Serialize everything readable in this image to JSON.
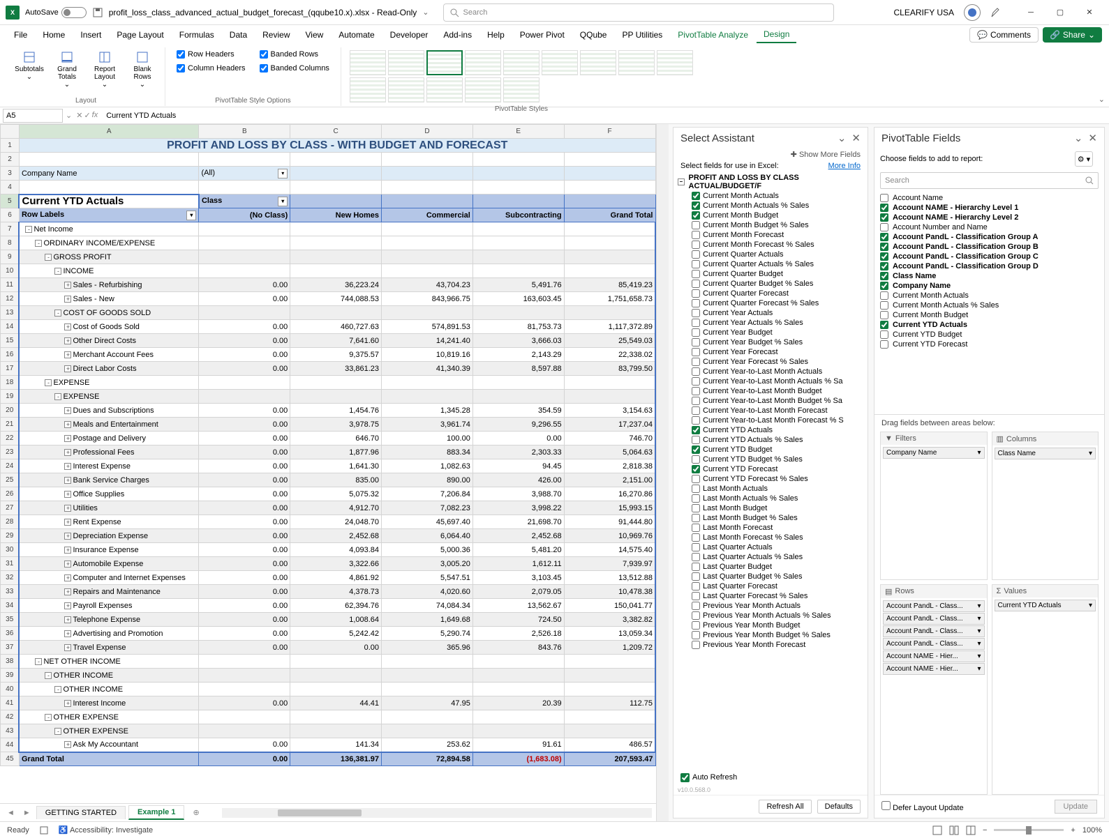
{
  "titlebar": {
    "autosave": "AutoSave",
    "autosave_state": "Off",
    "filename": "profit_loss_class_advanced_actual_budget_forecast_(qqube10.x).xlsx - Read-Only",
    "search_placeholder": "Search",
    "user": "CLEARIFY USA"
  },
  "menu": [
    "File",
    "Home",
    "Insert",
    "Page Layout",
    "Formulas",
    "Data",
    "Review",
    "View",
    "Automate",
    "Developer",
    "Add-ins",
    "Help",
    "Power Pivot",
    "QQube",
    "PP Utilities",
    "PivotTable Analyze",
    "Design"
  ],
  "menu_right": {
    "comments": "Comments",
    "share": "Share"
  },
  "ribbon": {
    "layout": {
      "label": "Layout",
      "subtotals": "Subtotals",
      "grand": "Grand\nTotals",
      "report": "Report\nLayout",
      "blank": "Blank\nRows"
    },
    "style_opts": {
      "label": "PivotTable Style Options",
      "row_headers": "Row Headers",
      "banded_rows": "Banded Rows",
      "col_headers": "Column Headers",
      "banded_cols": "Banded Columns"
    },
    "styles": {
      "label": "PivotTable Styles"
    }
  },
  "fxbar": {
    "cell": "A5",
    "formula": "Current YTD Actuals"
  },
  "sheet": {
    "title": "PROFIT AND LOSS BY CLASS - WITH BUDGET AND FORECAST",
    "company_label": "Company Name",
    "company_val": "(All)",
    "actuals": "Current YTD Actuals",
    "class": "Class",
    "row_labels": "Row Labels",
    "cols": [
      "(No Class)",
      "New Homes",
      "Commercial",
      "Subcontracting",
      "Grand Total"
    ],
    "rows": [
      {
        "n": 7,
        "l": "Net Income",
        "i": 1,
        "e": "-"
      },
      {
        "n": 8,
        "l": "ORDINARY INCOME/EXPENSE",
        "i": 2,
        "e": "-"
      },
      {
        "n": 9,
        "l": "GROSS PROFIT",
        "i": 3,
        "e": "-",
        "b": 1
      },
      {
        "n": 10,
        "l": "INCOME",
        "i": 4,
        "e": "-"
      },
      {
        "n": 11,
        "l": "Sales - Refurbishing",
        "i": 5,
        "e": "+",
        "b": 1,
        "v": [
          "0.00",
          "36,223.24",
          "43,704.23",
          "5,491.76",
          "85,419.23"
        ]
      },
      {
        "n": 12,
        "l": "Sales - New",
        "i": 5,
        "e": "+",
        "v": [
          "0.00",
          "744,088.53",
          "843,966.75",
          "163,603.45",
          "1,751,658.73"
        ]
      },
      {
        "n": 13,
        "l": "COST OF GOODS SOLD",
        "i": 4,
        "e": "-",
        "b": 1
      },
      {
        "n": 14,
        "l": "Cost of Goods Sold",
        "i": 5,
        "e": "+",
        "v": [
          "0.00",
          "460,727.63",
          "574,891.53",
          "81,753.73",
          "1,117,372.89"
        ]
      },
      {
        "n": 15,
        "l": "Other Direct Costs",
        "i": 5,
        "e": "+",
        "b": 1,
        "v": [
          "0.00",
          "7,641.60",
          "14,241.40",
          "3,666.03",
          "25,549.03"
        ]
      },
      {
        "n": 16,
        "l": "Merchant Account Fees",
        "i": 5,
        "e": "+",
        "v": [
          "0.00",
          "9,375.57",
          "10,819.16",
          "2,143.29",
          "22,338.02"
        ]
      },
      {
        "n": 17,
        "l": "Direct Labor Costs",
        "i": 5,
        "e": "+",
        "b": 1,
        "v": [
          "0.00",
          "33,861.23",
          "41,340.39",
          "8,597.88",
          "83,799.50"
        ]
      },
      {
        "n": 18,
        "l": "EXPENSE",
        "i": 3,
        "e": "-"
      },
      {
        "n": 19,
        "l": "EXPENSE",
        "i": 4,
        "e": "-",
        "b": 1
      },
      {
        "n": 20,
        "l": "Dues and Subscriptions",
        "i": 5,
        "e": "+",
        "v": [
          "0.00",
          "1,454.76",
          "1,345.28",
          "354.59",
          "3,154.63"
        ]
      },
      {
        "n": 21,
        "l": "Meals and Entertainment",
        "i": 5,
        "e": "+",
        "b": 1,
        "v": [
          "0.00",
          "3,978.75",
          "3,961.74",
          "9,296.55",
          "17,237.04"
        ]
      },
      {
        "n": 22,
        "l": "Postage and Delivery",
        "i": 5,
        "e": "+",
        "v": [
          "0.00",
          "646.70",
          "100.00",
          "0.00",
          "746.70"
        ]
      },
      {
        "n": 23,
        "l": "Professional Fees",
        "i": 5,
        "e": "+",
        "b": 1,
        "v": [
          "0.00",
          "1,877.96",
          "883.34",
          "2,303.33",
          "5,064.63"
        ]
      },
      {
        "n": 24,
        "l": "Interest Expense",
        "i": 5,
        "e": "+",
        "v": [
          "0.00",
          "1,641.30",
          "1,082.63",
          "94.45",
          "2,818.38"
        ]
      },
      {
        "n": 25,
        "l": "Bank Service Charges",
        "i": 5,
        "e": "+",
        "b": 1,
        "v": [
          "0.00",
          "835.00",
          "890.00",
          "426.00",
          "2,151.00"
        ]
      },
      {
        "n": 26,
        "l": "Office Supplies",
        "i": 5,
        "e": "+",
        "v": [
          "0.00",
          "5,075.32",
          "7,206.84",
          "3,988.70",
          "16,270.86"
        ]
      },
      {
        "n": 27,
        "l": "Utilities",
        "i": 5,
        "e": "+",
        "b": 1,
        "v": [
          "0.00",
          "4,912.70",
          "7,082.23",
          "3,998.22",
          "15,993.15"
        ]
      },
      {
        "n": 28,
        "l": "Rent Expense",
        "i": 5,
        "e": "+",
        "v": [
          "0.00",
          "24,048.70",
          "45,697.40",
          "21,698.70",
          "91,444.80"
        ]
      },
      {
        "n": 29,
        "l": "Depreciation Expense",
        "i": 5,
        "e": "+",
        "b": 1,
        "v": [
          "0.00",
          "2,452.68",
          "6,064.40",
          "2,452.68",
          "10,969.76"
        ]
      },
      {
        "n": 30,
        "l": "Insurance Expense",
        "i": 5,
        "e": "+",
        "v": [
          "0.00",
          "4,093.84",
          "5,000.36",
          "5,481.20",
          "14,575.40"
        ]
      },
      {
        "n": 31,
        "l": "Automobile Expense",
        "i": 5,
        "e": "+",
        "b": 1,
        "v": [
          "0.00",
          "3,322.66",
          "3,005.20",
          "1,612.11",
          "7,939.97"
        ]
      },
      {
        "n": 32,
        "l": "Computer and Internet Expenses",
        "i": 5,
        "e": "+",
        "v": [
          "0.00",
          "4,861.92",
          "5,547.51",
          "3,103.45",
          "13,512.88"
        ]
      },
      {
        "n": 33,
        "l": "Repairs and Maintenance",
        "i": 5,
        "e": "+",
        "b": 1,
        "v": [
          "0.00",
          "4,378.73",
          "4,020.60",
          "2,079.05",
          "10,478.38"
        ]
      },
      {
        "n": 34,
        "l": "Payroll Expenses",
        "i": 5,
        "e": "+",
        "v": [
          "0.00",
          "62,394.76",
          "74,084.34",
          "13,562.67",
          "150,041.77"
        ]
      },
      {
        "n": 35,
        "l": "Telephone Expense",
        "i": 5,
        "e": "+",
        "b": 1,
        "v": [
          "0.00",
          "1,008.64",
          "1,649.68",
          "724.50",
          "3,382.82"
        ]
      },
      {
        "n": 36,
        "l": "Advertising and Promotion",
        "i": 5,
        "e": "+",
        "v": [
          "0.00",
          "5,242.42",
          "5,290.74",
          "2,526.18",
          "13,059.34"
        ]
      },
      {
        "n": 37,
        "l": "Travel Expense",
        "i": 5,
        "e": "+",
        "b": 1,
        "v": [
          "0.00",
          "0.00",
          "365.96",
          "843.76",
          "1,209.72"
        ]
      },
      {
        "n": 38,
        "l": "NET OTHER INCOME",
        "i": 2,
        "e": "-"
      },
      {
        "n": 39,
        "l": "OTHER INCOME",
        "i": 3,
        "e": "-",
        "b": 1
      },
      {
        "n": 40,
        "l": "OTHER INCOME",
        "i": 4,
        "e": "-"
      },
      {
        "n": 41,
        "l": "Interest Income",
        "i": 5,
        "e": "+",
        "b": 1,
        "v": [
          "0.00",
          "44.41",
          "47.95",
          "20.39",
          "112.75"
        ]
      },
      {
        "n": 42,
        "l": "OTHER EXPENSE",
        "i": 3,
        "e": "-"
      },
      {
        "n": 43,
        "l": "OTHER EXPENSE",
        "i": 4,
        "e": "-",
        "b": 1
      },
      {
        "n": 44,
        "l": "Ask My Accountant",
        "i": 5,
        "e": "+",
        "v": [
          "0.00",
          "141.34",
          "253.62",
          "91.61",
          "486.57"
        ]
      }
    ],
    "grand_total": {
      "label": "Grand Total",
      "v": [
        "0.00",
        "136,381.97",
        "72,894.58",
        "(1,683.08)",
        "207,593.47"
      ]
    }
  },
  "panel1": {
    "title": "Select Assistant",
    "show_more": "Show More Fields",
    "instr": "Select fields for use in Excel:",
    "more": "More Info",
    "root": "PROFIT AND LOSS BY CLASS ACTUAL/BUDGET/F",
    "items": [
      {
        "l": "Current Month Actuals",
        "c": 1
      },
      {
        "l": "Current Month Actuals % Sales",
        "c": 1
      },
      {
        "l": "Current Month Budget",
        "c": 1
      },
      {
        "l": "Current Month Budget % Sales"
      },
      {
        "l": "Current Month Forecast"
      },
      {
        "l": "Current Month Forecast % Sales"
      },
      {
        "l": "Current Quarter Actuals"
      },
      {
        "l": "Current Quarter Actuals % Sales"
      },
      {
        "l": "Current Quarter Budget"
      },
      {
        "l": "Current Quarter Budget % Sales"
      },
      {
        "l": "Current Quarter Forecast"
      },
      {
        "l": "Current Quarter Forecast % Sales"
      },
      {
        "l": "Current Year Actuals"
      },
      {
        "l": "Current Year Actuals % Sales"
      },
      {
        "l": "Current Year Budget"
      },
      {
        "l": "Current Year Budget % Sales"
      },
      {
        "l": "Current Year Forecast"
      },
      {
        "l": "Current Year Forecast % Sales"
      },
      {
        "l": "Current Year-to-Last Month Actuals"
      },
      {
        "l": "Current Year-to-Last Month Actuals % Sa"
      },
      {
        "l": "Current Year-to-Last Month Budget"
      },
      {
        "l": "Current Year-to-Last Month Budget % Sa"
      },
      {
        "l": "Current Year-to-Last Month Forecast"
      },
      {
        "l": "Current Year-to-Last Month Forecast % S"
      },
      {
        "l": "Current YTD Actuals",
        "c": 1
      },
      {
        "l": "Current YTD Actuals % Sales"
      },
      {
        "l": "Current YTD Budget",
        "c": 1
      },
      {
        "l": "Current YTD Budget % Sales"
      },
      {
        "l": "Current YTD Forecast",
        "c": 1
      },
      {
        "l": "Current YTD Forecast % Sales"
      },
      {
        "l": "Last Month Actuals"
      },
      {
        "l": "Last Month Actuals % Sales"
      },
      {
        "l": "Last Month Budget"
      },
      {
        "l": "Last Month Budget % Sales"
      },
      {
        "l": "Last Month Forecast"
      },
      {
        "l": "Last Month Forecast % Sales"
      },
      {
        "l": "Last Quarter Actuals"
      },
      {
        "l": "Last Quarter Actuals % Sales"
      },
      {
        "l": "Last Quarter Budget"
      },
      {
        "l": "Last Quarter Budget % Sales"
      },
      {
        "l": "Last Quarter Forecast"
      },
      {
        "l": "Last Quarter Forecast % Sales"
      },
      {
        "l": "Previous Year Month Actuals"
      },
      {
        "l": "Previous Year Month Actuals % Sales"
      },
      {
        "l": "Previous Year Month Budget"
      },
      {
        "l": "Previous Year Month Budget % Sales"
      },
      {
        "l": "Previous Year Month Forecast"
      }
    ],
    "auto": "Auto Refresh",
    "refresh": "Refresh All",
    "defaults": "Defaults",
    "ver": "v10.0.568.0"
  },
  "panel2": {
    "title": "PivotTable Fields",
    "choose": "Choose fields to add to report:",
    "search": "Search",
    "items": [
      {
        "l": "Account Name"
      },
      {
        "l": "Account NAME - Hierarchy Level 1",
        "c": 1
      },
      {
        "l": "Account NAME - Hierarchy Level 2",
        "c": 1
      },
      {
        "l": "Account Number and Name"
      },
      {
        "l": "Account PandL - Classification Group A",
        "c": 1
      },
      {
        "l": "Account PandL - Classification Group B",
        "c": 1
      },
      {
        "l": "Account PandL - Classification Group C",
        "c": 1
      },
      {
        "l": "Account PandL - Classification Group D",
        "c": 1
      },
      {
        "l": "Class Name",
        "c": 1
      },
      {
        "l": "Company Name",
        "c": 1
      },
      {
        "l": "Current Month Actuals"
      },
      {
        "l": "Current Month Actuals % Sales"
      },
      {
        "l": "Current Month Budget"
      },
      {
        "l": "Current YTD Actuals",
        "c": 1
      },
      {
        "l": "Current YTD Budget"
      },
      {
        "l": "Current YTD Forecast"
      }
    ],
    "drag": "Drag fields between areas below:",
    "areas": {
      "filters": {
        "label": "Filters",
        "chips": [
          "Company Name"
        ]
      },
      "columns": {
        "label": "Columns",
        "chips": [
          "Class Name"
        ]
      },
      "rows": {
        "label": "Rows",
        "chips": [
          "Account PandL - Class...",
          "Account PandL - Class...",
          "Account PandL - Class...",
          "Account PandL - Class...",
          "Account NAME - Hier...",
          "Account NAME - Hier..."
        ]
      },
      "values": {
        "label": "Values",
        "chips": [
          "Current YTD Actuals"
        ]
      }
    },
    "defer": "Defer Layout Update",
    "update": "Update"
  },
  "tabs": {
    "t1": "GETTING STARTED",
    "t2": "Example 1"
  },
  "status": {
    "ready": "Ready",
    "access": "Accessibility: Investigate",
    "zoom": "100%"
  }
}
